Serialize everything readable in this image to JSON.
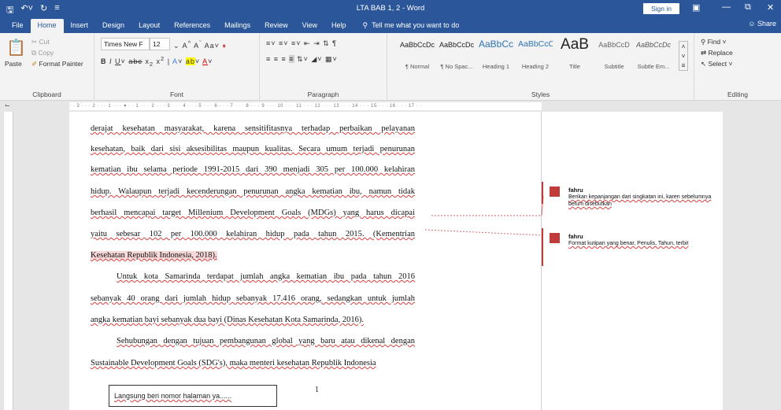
{
  "titlebar": {
    "title": "LTA BAB 1, 2  -  Word",
    "signin": "Sign in"
  },
  "tabs": [
    "File",
    "Home",
    "Insert",
    "Design",
    "Layout",
    "References",
    "Mailings",
    "Review",
    "View",
    "Help"
  ],
  "tellme": "Tell me what you want to do",
  "share": "Share",
  "clipboard": {
    "paste": "Paste",
    "cut": "Cut",
    "copy": "Copy",
    "format_painter": "Format Painter",
    "label": "Clipboard"
  },
  "font": {
    "name": "Times New F",
    "size": "12",
    "label": "Font"
  },
  "paragraph": {
    "label": "Paragraph"
  },
  "styles": {
    "label": "Styles",
    "items": [
      {
        "preview": "AaBbCcDc",
        "name": "¶ Normal"
      },
      {
        "preview": "AaBbCcDc",
        "name": "¶ No Spac..."
      },
      {
        "preview": "AaBbCc",
        "name": "Heading 1"
      },
      {
        "preview": "AaBbCcC",
        "name": "Heading 2"
      },
      {
        "preview": "AaB",
        "name": "Title"
      },
      {
        "preview": "AaBbCcD",
        "name": "Subtitle"
      },
      {
        "preview": "AaBbCcDc",
        "name": "Subtle Em..."
      }
    ]
  },
  "editing": {
    "find": "Find",
    "replace": "Replace",
    "select": "Select",
    "label": "Editing"
  },
  "document": {
    "lines": [
      "derajat kesehatan masyarakat, karena sensitifitasnya terhadap perbaikan pelayanan",
      "kesehatan, baik dari sisi aksesibilitas maupun kualitas. Secara umum terjadi penurunan",
      "kematian ibu selama periode 1991-2015 dari 390 menjadi 305 per 100.000 kelahiran",
      "hidup. Walaupun terjadi kecenderungan penurunan angka kematian ibu, namun tidak",
      "berhasil mencapai target Millenium Development Goals (MDGs) yang harus dicapai",
      "yaitu sebesar 102 per 100.000 kelahiran hidup pada tahun 2015. (Kementrian",
      "Kesehatan Republik Indonesia, 2018).",
      "Untuk kota Samarinda terdapat jumlah angka kematian ibu pada tahun 2016",
      "sebanyak 40 orang dari jumlah hidup sebanyak 17.416 orang, sedangkan untuk jumlah",
      "angka kematian bayi sebanyak dua bayi (Dinas Kesehatan Kota Samarinda, 2016).",
      "Sehubungan dengan tujuan pembangunan global yang baru atau dikenal dengan",
      "Sustainable Development Goals (SDG's), maka menteri kesehatan Republik Indonesia"
    ],
    "page_number": "1",
    "footer_note": "Langsung beri nomor halaman ya......"
  },
  "comments": [
    {
      "author": "fahru",
      "text": "Berikan kepanjangan dari singkatan ini, karen sebelumnya belum disebutkan"
    },
    {
      "author": "fahru",
      "text": "Format kutipan yang benar, Penulis, Tahun, terbit"
    }
  ],
  "colors": {
    "accent": "#2b579a",
    "comment": "#c23b3b"
  }
}
